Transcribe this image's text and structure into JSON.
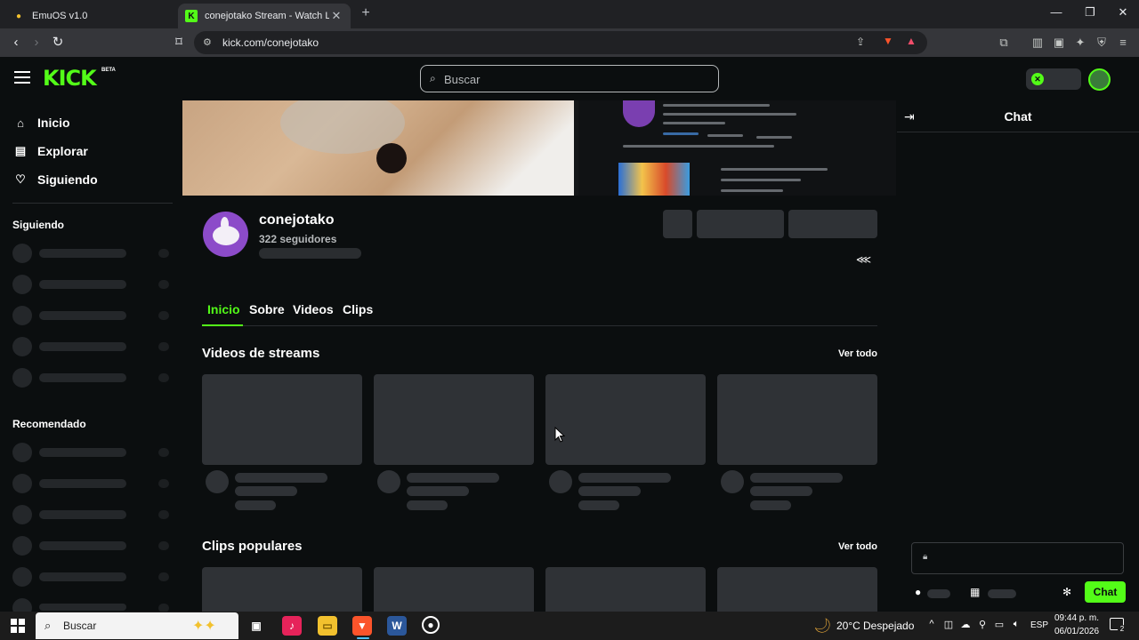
{
  "browser": {
    "tabs": [
      {
        "title": "EmuOS v1.0",
        "favicon": "emuos-favicon-icon",
        "active": false
      },
      {
        "title": "conejotako Stream - Watch Live",
        "favicon": "kick-favicon-icon",
        "active": true
      }
    ],
    "url": "kick.com/conejotako"
  },
  "kick": {
    "logo_text": "KICK",
    "logo_badge": "BETA",
    "search_placeholder": "Buscar",
    "brand_color": "#53fc18",
    "nav": [
      {
        "label": "Inicio",
        "icon": "home-icon"
      },
      {
        "label": "Explorar",
        "icon": "compass-icon"
      },
      {
        "label": "Siguiendo",
        "icon": "heart-icon"
      }
    ],
    "sidebar_sections": {
      "following": "Siguiendo",
      "recommended": "Recomendado"
    }
  },
  "channel": {
    "name": "conejotako",
    "followers": "322 seguidores",
    "tabs": [
      {
        "label": "Inicio",
        "active": true
      },
      {
        "label": "Sobre",
        "active": false
      },
      {
        "label": "Videos",
        "active": false
      },
      {
        "label": "Clips",
        "active": false
      }
    ],
    "sections": {
      "streams_title": "Videos de streams",
      "clips_title": "Clips populares",
      "see_all": "Ver todo"
    }
  },
  "chat": {
    "title": "Chat",
    "send_label": "Chat"
  },
  "taskbar": {
    "search_text": "Buscar",
    "weather_temp": "20°C",
    "weather_desc": "Despejado",
    "language": "ESP",
    "time": "09:44 p. m.",
    "date": "06/01/2026",
    "notification_count": "2"
  }
}
